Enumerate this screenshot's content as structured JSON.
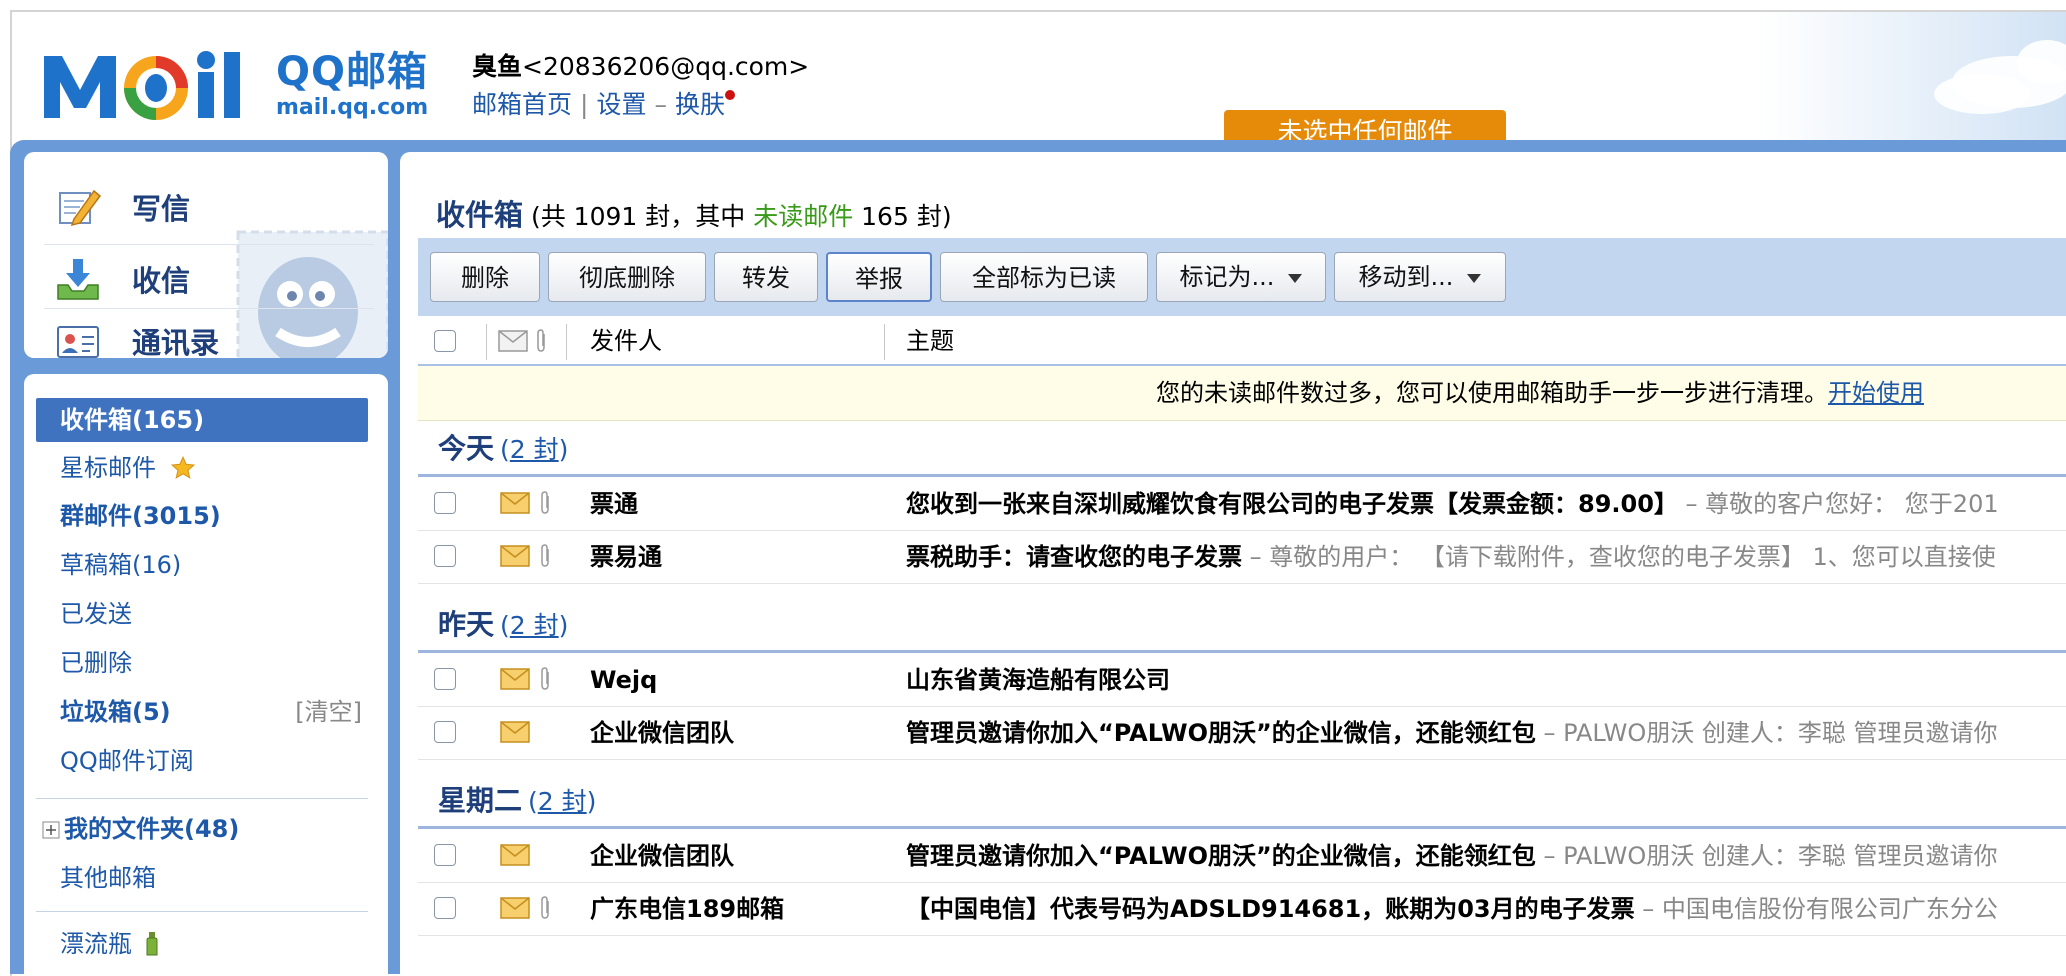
{
  "header": {
    "brand_cn": "QQ邮箱",
    "brand_en": "mail.qq.com",
    "user_nick": "臭鱼",
    "user_email": "<20836206@qq.com>",
    "links": {
      "home": "邮箱首页",
      "settings": "设置",
      "dash": "–",
      "skin": "换肤"
    },
    "notice": "未选中任何邮件"
  },
  "quick_actions": [
    {
      "label": "写信",
      "icon": "pen-icon"
    },
    {
      "label": "收信",
      "icon": "inbox-download-icon"
    },
    {
      "label": "通讯录",
      "icon": "contact-card-icon"
    }
  ],
  "folders": {
    "inbox": "收件箱(165)",
    "starred": "星标邮件",
    "group": "群邮件(3015)",
    "drafts": "草稿箱(16)",
    "sent": "已发送",
    "deleted": "已删除",
    "spam": "垃圾箱(5)",
    "spam_clear": "[清空]",
    "subscriptions": "QQ邮件订阅",
    "my_folders": "我的文件夹(48)",
    "other_mail": "其他邮箱",
    "drift_bottle": "漂流瓶"
  },
  "main": {
    "title": "收件箱",
    "summary_prefix": "(共 1091 封，其中 ",
    "summary_unread": "未读邮件",
    "summary_suffix": " 165 封)",
    "toolbar": {
      "delete": "删除",
      "delete_perm": "彻底删除",
      "forward": "转发",
      "report": "举报",
      "mark_all_read": "全部标为已读",
      "mark_as": "标记为...",
      "move_to": "移动到..."
    },
    "columns": {
      "sender": "发件人",
      "subject": "主题"
    },
    "tip_text": "您的未读邮件数过多，您可以使用邮箱助手一步一步进行清理。",
    "tip_link": "开始使用",
    "groups": [
      {
        "name": "今天",
        "count": "2 封",
        "emails": [
          {
            "sender": "票通",
            "subject": "您收到一张来自深圳威耀饮食有限公司的电子发票【发票金额：89.00】",
            "preview": " – 尊敬的客户您好：   您于201",
            "attachment": true
          },
          {
            "sender": "票易通",
            "subject": "票税助手：请查收您的电子发票",
            "preview": " – 尊敬的用户：   【请下载附件，查收您的电子发票】 1、您可以直接使",
            "attachment": true
          }
        ]
      },
      {
        "name": "昨天",
        "count": "2 封",
        "emails": [
          {
            "sender": "Wejq",
            "subject": "山东省黄海造船有限公司",
            "preview": "",
            "attachment": true
          },
          {
            "sender": "企业微信团队",
            "subject": "管理员邀请你加入“PALWO朋沃”的企业微信，还能领红包",
            "preview": " –  PALWO朋沃 创建人：李聪 管理员邀请你",
            "attachment": false
          }
        ]
      },
      {
        "name": "星期二",
        "count": "2 封",
        "emails": [
          {
            "sender": "企业微信团队",
            "subject": "管理员邀请你加入“PALWO朋沃”的企业微信，还能领红包",
            "preview": " –  PALWO朋沃 创建人：李聪 管理员邀请你",
            "attachment": false
          },
          {
            "sender": "广东电信189邮箱",
            "subject": "【中国电信】代表号码为ADSLD914681，账期为03月的电子发票",
            "preview": " – 中国电信股份有限公司广东分公",
            "attachment": true
          }
        ]
      }
    ]
  },
  "colors": {
    "brand_blue": "#1f72c9",
    "band_blue": "#6a9ad8",
    "active_folder": "#3f73c0",
    "notice_orange": "#e68a0a",
    "unread_green": "#3a9a1a"
  }
}
